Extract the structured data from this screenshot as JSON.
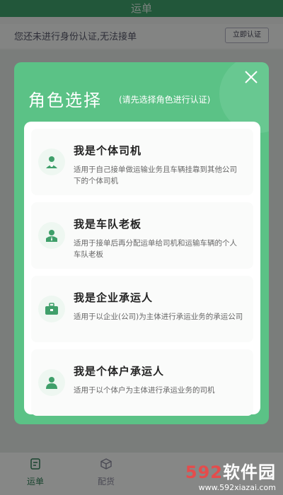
{
  "app": {
    "title": "运单",
    "notice_text": "您还未进行身份认证,无法接单",
    "notice_button": "立即认证",
    "tabs": [
      {
        "label": "运单",
        "icon": "document-icon"
      },
      {
        "label": "配货",
        "icon": "box-icon"
      }
    ]
  },
  "modal": {
    "title": "角色选择",
    "subtitle": "(请先选择角色进行认证)",
    "roles": [
      {
        "name": "我是个体司机",
        "desc": "适用于自己接单做运输业务且车辆挂靠到其他公司下的个体司机",
        "icon": "driver-icon"
      },
      {
        "name": "我是车队老板",
        "desc": "适用于接单后再分配运单给司机和运输车辆的个人车队老板",
        "icon": "boss-icon"
      },
      {
        "name": "我是企业承运人",
        "desc": "适用于以企业(公司)为主体进行承运业务的承运公司",
        "icon": "briefcase-icon"
      },
      {
        "name": "我是个体户承运人",
        "desc": "适用于以个体户为主体进行承运业务的司机",
        "icon": "person-icon"
      }
    ]
  },
  "watermark": {
    "logo_num": "592",
    "logo_text": "软件园",
    "url": "www.592xiazai.com"
  },
  "colors": {
    "accent": "#5bc286",
    "icon": "#3f9f6a"
  }
}
